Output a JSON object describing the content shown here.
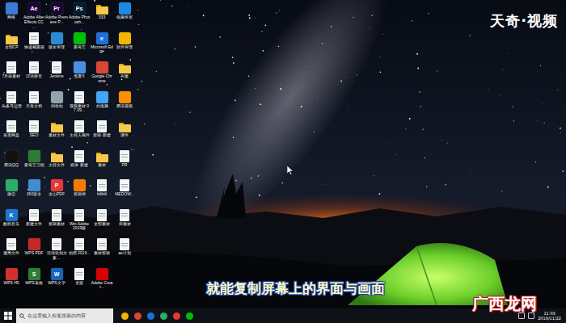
{
  "watermark": "天奇·视频",
  "subtitle": "就能复制屏幕上的界面与画面",
  "site_logo": "广西龙网",
  "desktop": {
    "icons": [
      {
        "label": "网络",
        "kind": "app",
        "color": "#3a7bd5"
      },
      {
        "label": "Adobe After Effects CC ...",
        "kind": "app",
        "color": "#1a0536",
        "glyph": "Ae"
      },
      {
        "label": "Adobe Premiere P...",
        "kind": "app",
        "color": "#1a0536",
        "glyph": "Pr"
      },
      {
        "label": "Adobe Photosh...",
        "kind": "app",
        "color": "#001e36",
        "glyph": "Ps"
      },
      {
        "label": "333",
        "kind": "folder"
      },
      {
        "label": "电脑管家",
        "kind": "app",
        "color": "#1e88e5"
      },
      {
        "label": "全部CP",
        "kind": "folder"
      },
      {
        "label": "快速截图器",
        "kind": "doc"
      },
      {
        "label": "版本管理",
        "kind": "app",
        "color": "#2b8ad6"
      },
      {
        "label": "爱奇艺",
        "kind": "app",
        "color": "#00be06"
      },
      {
        "label": "Microsoft Edge",
        "kind": "app",
        "color": "#1e6fd9",
        "glyph": "e"
      },
      {
        "label": "软件管理",
        "kind": "app",
        "color": "#f4b400"
      },
      {
        "label": "7月份素材",
        "kind": "doc"
      },
      {
        "label": "汉语拼音",
        "kind": "doc"
      },
      {
        "label": "Jenkins",
        "kind": "doc"
      },
      {
        "label": "迅雷X",
        "kind": "app",
        "color": "#4a90e2"
      },
      {
        "label": "Google Chrome",
        "kind": "app",
        "color": "#db4437"
      },
      {
        "label": "AI素",
        "kind": "folder"
      },
      {
        "label": "头条号运营",
        "kind": "doc"
      },
      {
        "label": "天奇文档",
        "kind": "doc"
      },
      {
        "label": "回收站",
        "kind": "app",
        "color": "#90a4ae"
      },
      {
        "label": "视频素材 07.09...",
        "kind": "doc"
      },
      {
        "label": "此电脑",
        "kind": "app",
        "color": "#42a5f5"
      },
      {
        "label": "腾讯视频",
        "kind": "app",
        "color": "#ff8f00"
      },
      {
        "label": "百度网盘",
        "kind": "doc"
      },
      {
        "label": "SEO",
        "kind": "doc"
      },
      {
        "label": "素材文件",
        "kind": "folder"
      },
      {
        "label": "主持人稿件",
        "kind": "doc"
      },
      {
        "label": "剪辑·新建",
        "kind": "doc"
      },
      {
        "label": "课件",
        "kind": "folder"
      },
      {
        "label": "腾讯QQ",
        "kind": "app",
        "color": "#111111"
      },
      {
        "label": "爱奇艺万能",
        "kind": "app",
        "color": "#2e7d32"
      },
      {
        "label": "主持文件",
        "kind": "folder"
      },
      {
        "label": "媒体 新建",
        "kind": "doc"
      },
      {
        "label": "素材",
        "kind": "folder"
      },
      {
        "label": "PR",
        "kind": "doc"
      },
      {
        "label": "微信",
        "kind": "app",
        "color": "#2aae67"
      },
      {
        "label": "360安全",
        "kind": "app",
        "color": "#3e8ed0"
      },
      {
        "label": "金山PDF",
        "kind": "app",
        "color": "#e53935",
        "glyph": "P"
      },
      {
        "label": "剪辑师",
        "kind": "app",
        "color": "#f57c00"
      },
      {
        "label": "bilibili",
        "kind": "doc"
      },
      {
        "label": "MEDOW...",
        "kind": "doc"
      },
      {
        "label": "酷狗音乐",
        "kind": "app",
        "color": "#1976d2",
        "glyph": "K"
      },
      {
        "label": "新建文件",
        "kind": "doc"
      },
      {
        "label": "剪辑素材",
        "kind": "doc"
      },
      {
        "label": "Win Adobe 2019版",
        "kind": "doc"
      },
      {
        "label": "全部素材",
        "kind": "doc"
      },
      {
        "label": "和素材",
        "kind": "doc"
      },
      {
        "label": "通用文件",
        "kind": "doc"
      },
      {
        "label": "WPS PDF",
        "kind": "app",
        "color": "#c62828"
      },
      {
        "label": "活动策划文案...",
        "kind": "doc"
      },
      {
        "label": "拍照 2019...",
        "kind": "doc"
      },
      {
        "label": "素材剪辑",
        "kind": "doc"
      },
      {
        "label": "ae计划",
        "kind": "doc"
      },
      {
        "label": "WPS H5",
        "kind": "app",
        "color": "#d32f2f"
      },
      {
        "label": "WPS表格",
        "kind": "app",
        "color": "#2e7d32",
        "glyph": "S"
      },
      {
        "label": "WPS文字",
        "kind": "app",
        "color": "#1565c0",
        "glyph": "W"
      },
      {
        "label": "桌面",
        "kind": "doc"
      },
      {
        "label": "Adobe Creat...",
        "kind": "app",
        "color": "#d50000"
      }
    ]
  },
  "taskbar": {
    "search": {
      "placeholder": "在这里输入你要搜索的内容"
    },
    "apps": [
      {
        "color": "#f4b400"
      },
      {
        "color": "#db4437"
      },
      {
        "color": "#1e6fd9"
      },
      {
        "color": "#2aae67"
      },
      {
        "color": "#e53935"
      },
      {
        "color": "#00be06"
      }
    ],
    "clock": {
      "time": "11:03",
      "date": "2019/11/22"
    }
  }
}
